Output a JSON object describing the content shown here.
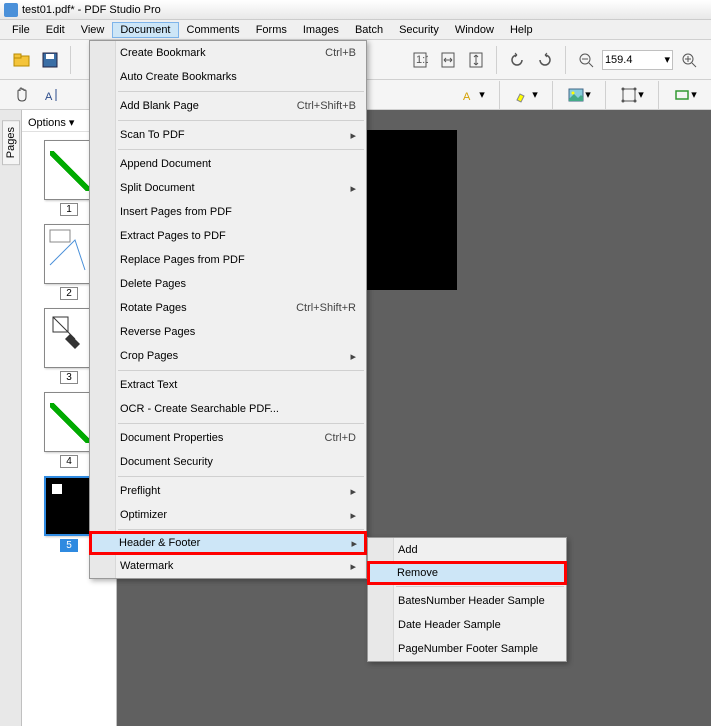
{
  "title": "test01.pdf* - PDF Studio Pro",
  "menubar": [
    "File",
    "Edit",
    "View",
    "Document",
    "Comments",
    "Forms",
    "Images",
    "Batch",
    "Security",
    "Window",
    "Help"
  ],
  "active_menu_index": 3,
  "zoom": "159.4",
  "options_label": "Options",
  "sidetab_label": "Pages",
  "thumbs": [
    {
      "num": "1"
    },
    {
      "num": "2"
    },
    {
      "num": "3"
    },
    {
      "num": "4"
    },
    {
      "num": "5"
    }
  ],
  "selected_thumb": 5,
  "doc_menu": {
    "groups": [
      [
        {
          "label": "Create Bookmark",
          "shortcut": "Ctrl+B",
          "icon": "bookmark"
        },
        {
          "label": "Auto Create Bookmarks"
        }
      ],
      [
        {
          "label": "Add Blank Page",
          "shortcut": "Ctrl+Shift+B",
          "icon": "blank-page"
        }
      ],
      [
        {
          "label": "Scan To PDF",
          "submenu": true,
          "icon": "scanner"
        }
      ],
      [
        {
          "label": "Append Document"
        },
        {
          "label": "Split Document",
          "submenu": true
        },
        {
          "label": "Insert Pages from PDF"
        },
        {
          "label": "Extract Pages to PDF"
        },
        {
          "label": "Replace Pages from PDF"
        },
        {
          "label": "Delete Pages"
        },
        {
          "label": "Rotate Pages",
          "shortcut": "Ctrl+Shift+R"
        },
        {
          "label": "Reverse Pages"
        },
        {
          "label": "Crop Pages",
          "submenu": true,
          "icon": "crop"
        }
      ],
      [
        {
          "label": "Extract Text"
        },
        {
          "label": "OCR - Create Searchable PDF..."
        }
      ],
      [
        {
          "label": "Document Properties",
          "shortcut": "Ctrl+D"
        },
        {
          "label": "Document Security",
          "icon": "security"
        }
      ],
      [
        {
          "label": "Preflight",
          "submenu": true
        },
        {
          "label": "Optimizer",
          "submenu": true
        }
      ],
      [
        {
          "label": "Header & Footer",
          "submenu": true,
          "hover": true,
          "highlight": true
        },
        {
          "label": "Watermark",
          "submenu": true
        }
      ]
    ]
  },
  "submenu": {
    "groups": [
      [
        {
          "label": "Add"
        },
        {
          "label": "Remove",
          "hover": true,
          "highlight": true
        }
      ],
      [
        {
          "label": "BatesNumber Header Sample"
        },
        {
          "label": "Date Header Sample"
        },
        {
          "label": "PageNumber Footer Sample"
        }
      ]
    ]
  }
}
